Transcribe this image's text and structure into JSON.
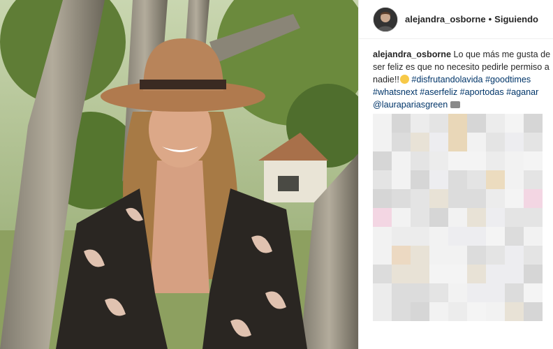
{
  "post": {
    "username": "alejandra_osborne",
    "separator": "•",
    "follow_status": "Siguiendo",
    "caption": {
      "username": "alejandra_osborne",
      "text": "Lo que más me gusta de ser feliz es que no necesito pedirle permiso a nadie!!",
      "hashtags": [
        "#disfrutandolavida",
        "#goodtimes",
        "#whatsnext",
        "#aserfeliz",
        "#aportodas",
        "#aganar"
      ],
      "mention": "@laurapariasgreen"
    }
  },
  "icons": {
    "avatar": "profile-avatar",
    "emoji": "smiling-face-icon",
    "camera": "camera-icon"
  },
  "colors": {
    "text": "#262626",
    "hashtag": "#003569",
    "border": "#efefef"
  }
}
